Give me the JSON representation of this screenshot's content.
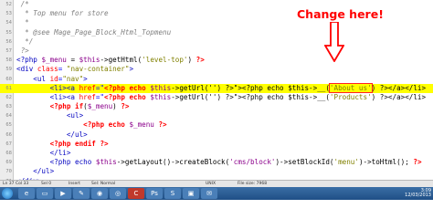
{
  "annotation": {
    "label": "Change here!"
  },
  "editor": {
    "lines": [
      {
        "num": "52",
        "type": "cm",
        "text": " /*"
      },
      {
        "num": "53",
        "type": "cm",
        "text": "  * Top menu for store"
      },
      {
        "num": "54",
        "type": "cm",
        "text": "  *"
      },
      {
        "num": "55",
        "type": "cm",
        "text": "  * @see Mage_Page_Block_Html_Topmenu"
      },
      {
        "num": "56",
        "type": "cm",
        "text": "  */"
      },
      {
        "num": "57",
        "type": "cm",
        "text": " ?>"
      },
      {
        "num": "58",
        "type": "code1",
        "a": "<?php ",
        "b": "$_menu",
        "c": " = ",
        "d": "$this",
        "e": "->getHtml(",
        "f": "'level-top'",
        "g": ") ",
        "h": "?>"
      },
      {
        "num": "59",
        "type": "code2",
        "a": "<div ",
        "b": "class",
        "c": "= ",
        "d": "\"nav-container\"",
        "e": ">"
      },
      {
        "num": "60",
        "type": "code2",
        "a": "    <ul ",
        "b": "id",
        "c": "=",
        "d": "\"nav\"",
        "e": ">"
      },
      {
        "num": "61",
        "type": "hl",
        "a": "        <li><a ",
        "b": "href",
        "c": "=\"",
        "d": "<?php echo ",
        "e": "$this",
        "f": "->getUrl('') ?>\"><?php echo $this->__(",
        "g": "'About us'",
        "h": ") ?></a></li>"
      },
      {
        "num": "62",
        "type": "code3",
        "a": "        <li><a ",
        "b": "href",
        "c": "=\"",
        "d": "<?php echo ",
        "e": "$this",
        "f": "->getUrl('') ?>\"><?php echo $this->__(",
        "g": "'Products'",
        "h": ") ?></a></li>"
      },
      {
        "num": "63",
        "type": "code4",
        "a": "        ",
        "b": "<?php if",
        "c": "(",
        "d": "$_menu",
        "e": ") ",
        "f": "?>"
      },
      {
        "num": "64",
        "type": "plain",
        "text": "            <ul>"
      },
      {
        "num": "65",
        "type": "code4",
        "a": "                ",
        "b": "<?php echo ",
        "c": "",
        "d": "$_menu",
        "e": " ",
        "f": "?>"
      },
      {
        "num": "66",
        "type": "plain",
        "text": "            </ul>"
      },
      {
        "num": "67",
        "type": "code4",
        "a": "        ",
        "b": "<?php endif ",
        "c": "",
        "d": "",
        "e": "",
        "f": "?>"
      },
      {
        "num": "68",
        "type": "plain",
        "text": "        </li>"
      },
      {
        "num": "69",
        "type": "code1",
        "a": "        <?php echo ",
        "b": "$this",
        "c": "->getLayout()->createBlock(",
        "d": "'cms/block'",
        "e": ")->setBlockId(",
        "f": "'menu'",
        "g": ")->toHtml(); ",
        "h": "?>"
      },
      {
        "num": "70",
        "type": "plain",
        "text": "    </ul>"
      },
      {
        "num": "71",
        "type": "plain",
        "text": "</div>"
      }
    ]
  },
  "statusbar": {
    "pos": "Ln 37  Col 33",
    "sel": "Sel 0",
    "ins": "Insert",
    "mode": "Sel: Normal",
    "eol": "UNIX",
    "size": "File size: 7968"
  },
  "taskbar": {
    "time": "3:09",
    "date": "12/03/2013"
  },
  "colors": {
    "highlight": "#ffff00",
    "annotation": "#ff0000"
  }
}
